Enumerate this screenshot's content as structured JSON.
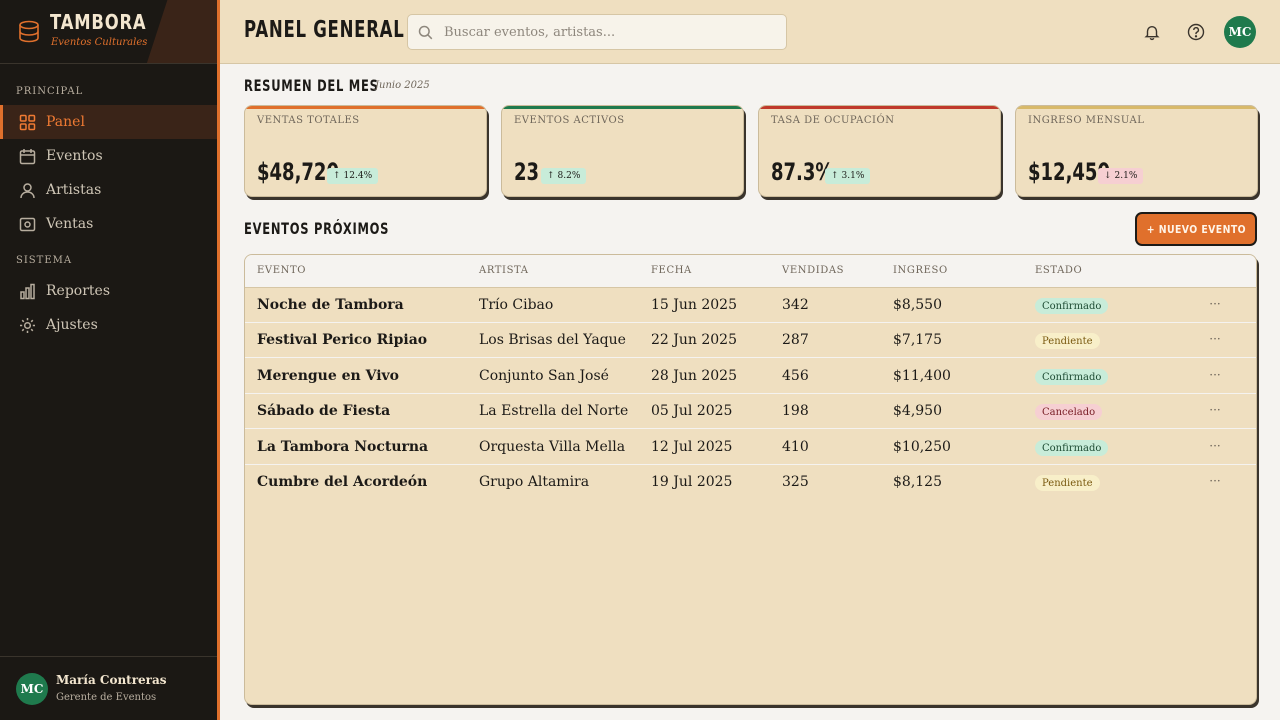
{
  "brand": {
    "name": "TAMBORA",
    "subtitle": "Eventos Culturales",
    "accent": "#e0702c"
  },
  "sidebar": {
    "sections": [
      {
        "label": "PRINCIPAL",
        "items": [
          {
            "label": "Panel",
            "icon": "grid-icon",
            "active": true
          },
          {
            "label": "Eventos",
            "icon": "calendar-icon"
          },
          {
            "label": "Artistas",
            "icon": "user-icon"
          },
          {
            "label": "Ventas",
            "icon": "cash-icon"
          }
        ]
      },
      {
        "label": "SISTEMA",
        "items": [
          {
            "label": "Reportes",
            "icon": "bar-chart-icon"
          },
          {
            "label": "Ajustes",
            "icon": "gear-icon"
          }
        ]
      }
    ],
    "user": {
      "initials": "MC",
      "name": "María Contreras",
      "role": "Gerente de Eventos"
    }
  },
  "header": {
    "title": "PANEL GENERAL",
    "search": {
      "placeholder": "Buscar eventos, artistas...",
      "value": ""
    },
    "icons": [
      "bell-icon",
      "help-icon"
    ],
    "user_initials": "MC"
  },
  "summary": {
    "title": "RESUMEN DEL MES",
    "period": "Junio 2025",
    "cards": [
      {
        "label": "VENTAS TOTALES",
        "value": "$48,720",
        "change": "12.4%",
        "trend": "up",
        "color": "#e0702c"
      },
      {
        "label": "EVENTOS ACTIVOS",
        "value": "23",
        "change": "8.2%",
        "trend": "up",
        "color": "#1f7a4d"
      },
      {
        "label": "TASA DE OCUPACIÓN",
        "value": "87.3%",
        "change": "3.1%",
        "trend": "up",
        "color": "#c0392b"
      },
      {
        "label": "INGRESO MENSUAL",
        "value": "$12,450",
        "change": "2.1%",
        "trend": "down",
        "color": "#d8b96a"
      }
    ]
  },
  "events": {
    "title": "EVENTOS PRÓXIMOS",
    "new_button": "+ NUEVO EVENTO",
    "columns": [
      "EVENTO",
      "ARTISTA",
      "FECHA",
      "VENDIDAS",
      "INGRESO",
      "ESTADO"
    ],
    "rows": [
      {
        "event": "Noche de Tambora",
        "artist": "Trío Cibao",
        "date": "15 Jun 2025",
        "sold": "342",
        "revenue": "$8,550",
        "status": "Confirmado"
      },
      {
        "event": "Festival Perico Ripiao",
        "artist": "Los Brisas del Yaque",
        "date": "22 Jun 2025",
        "sold": "287",
        "revenue": "$7,175",
        "status": "Pendiente"
      },
      {
        "event": "Merengue en Vivo",
        "artist": "Conjunto San José",
        "date": "28 Jun 2025",
        "sold": "456",
        "revenue": "$11,400",
        "status": "Confirmado"
      },
      {
        "event": "Sábado de Fiesta",
        "artist": "La Estrella del Norte",
        "date": "05 Jul 2025",
        "sold": "198",
        "revenue": "$4,950",
        "status": "Cancelado"
      },
      {
        "event": "La Tambora Nocturna",
        "artist": "Orquesta Villa Mella",
        "date": "12 Jul 2025",
        "sold": "410",
        "revenue": "$10,250",
        "status": "Confirmado"
      },
      {
        "event": "Cumbre del Acordeón",
        "artist": "Grupo Altamira",
        "date": "19 Jul 2025",
        "sold": "325",
        "revenue": "$8,125",
        "status": "Pendiente"
      }
    ],
    "row_menu": "···"
  }
}
